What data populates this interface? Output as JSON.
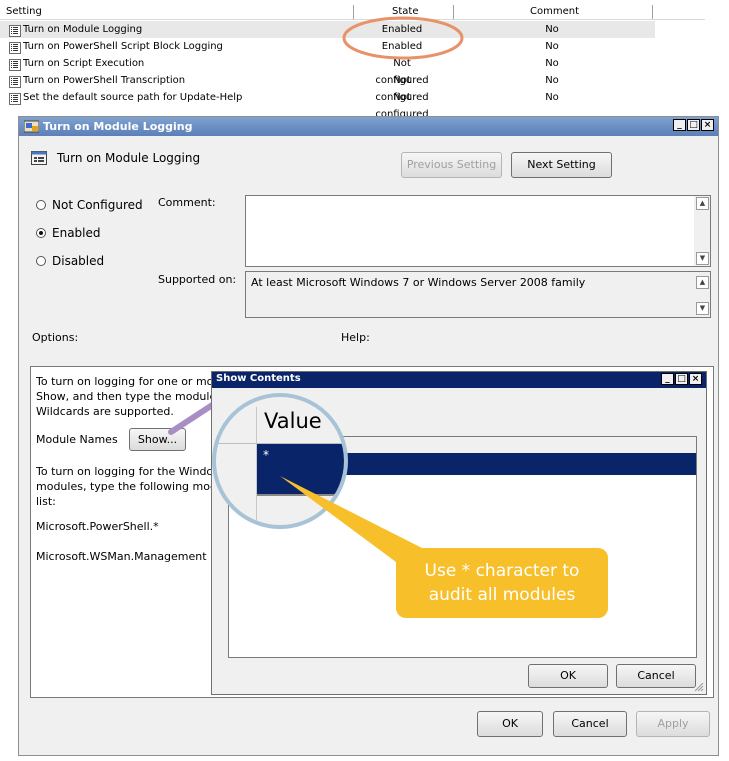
{
  "list": {
    "columns": {
      "setting": "Setting",
      "state": "State",
      "comment": "Comment"
    },
    "rows": [
      {
        "name": "Turn on Module Logging",
        "state": "Enabled",
        "comment": "No"
      },
      {
        "name": "Turn on PowerShell Script Block Logging",
        "state": "Enabled",
        "comment": "No"
      },
      {
        "name": "Turn on Script Execution",
        "state": "Not configured",
        "comment": "No"
      },
      {
        "name": "Turn on PowerShell Transcription",
        "state": "Not configured",
        "comment": "No"
      },
      {
        "name": "Set the default source path for Update-Help",
        "state": "Not configured",
        "comment": "No"
      }
    ]
  },
  "dialog": {
    "title": "Turn on Module Logging",
    "heading": "Turn on Module Logging",
    "prev_button": "Previous Setting",
    "next_button": "Next Setting",
    "radio_not_configured": "Not Configured",
    "radio_enabled": "Enabled",
    "radio_disabled": "Disabled",
    "selected_radio": "Enabled",
    "comment_label": "Comment:",
    "supported_label": "Supported on:",
    "supported_value": "At least Microsoft Windows 7 or Windows Server 2008 family",
    "options_label": "Options:",
    "help_label": "Help:",
    "options_text_1": "To turn on logging for one or mo",
    "options_text_2": "Show, and then type the module",
    "options_text_3": "Wildcards are supported.",
    "module_names_label": "Module Names",
    "show_button": "Show...",
    "options_text_4": "To turn on logging for the Windo",
    "options_text_5": "modules, type the following mod",
    "options_text_6": "list:",
    "module_1": "Microsoft.PowerShell.*",
    "module_2": "Microsoft.WSMan.Management",
    "ok_button": "OK",
    "cancel_button": "Cancel",
    "apply_button": "Apply"
  },
  "show_contents": {
    "title": "Show Contents",
    "column_value": "Value",
    "row_value": "*",
    "ok_button": "OK",
    "cancel_button": "Cancel"
  },
  "callout": {
    "line1": "Use * character to",
    "line2": "audit all modules"
  },
  "colors": {
    "highlight_ellipse": "#e8926a",
    "callout": "#f7bf2a",
    "selection": "#0a246a",
    "lens_border": "#a9c3d6"
  }
}
